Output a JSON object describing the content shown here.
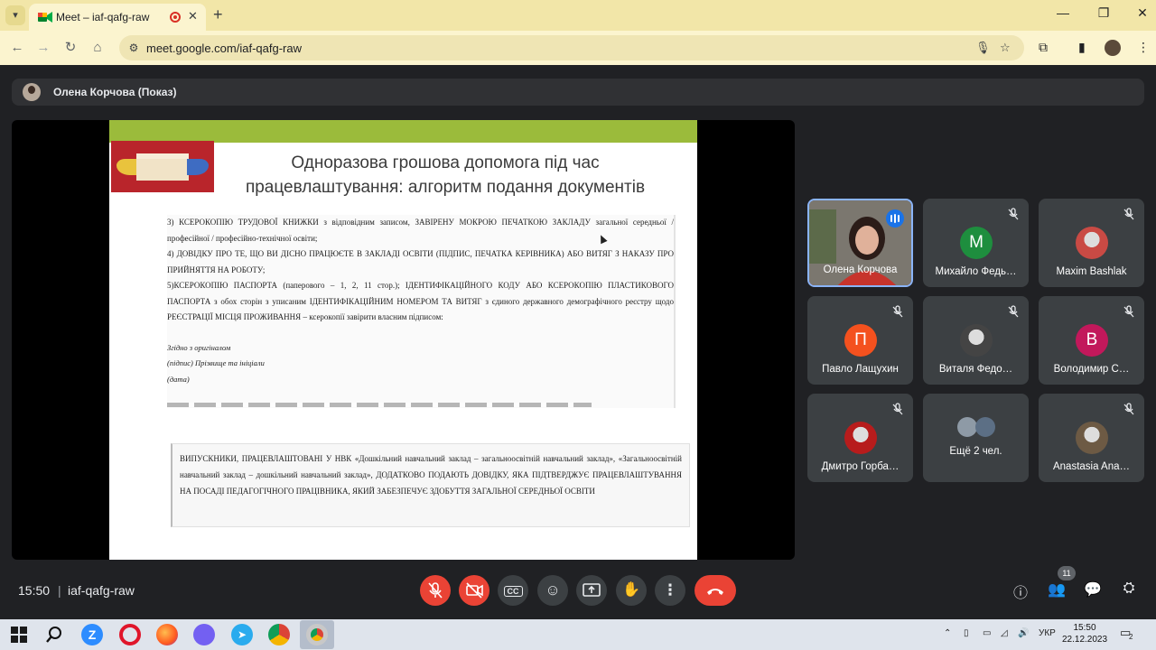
{
  "browser": {
    "tab_title": "Meet – iaf-qafg-raw",
    "url": "meet.google.com/iaf-qafg-raw",
    "tab_close": "✕",
    "new_tab": "+",
    "accent": "#f2e6a8"
  },
  "meet": {
    "presenter_label": "Олена Корчова (Показ)",
    "time": "15:50",
    "separator": "|",
    "meeting_code": "iaf-qafg-raw",
    "participant_count": "11"
  },
  "slide": {
    "title_line1": "Одноразова грошова допомога під час",
    "title_line2": "працевлаштування: алгоритм подання документів",
    "doc1": {
      "p1": "3) КСЕРОКОПІЮ ТРУДОВОЇ КНИЖКИ з відповідним записом, ЗАВІРЕНУ МОКРОЮ ПЕЧАТКОЮ ЗАКЛАДУ загальної середньої / професійної / професійно-технічної освіти;",
      "p2": "4) ДОВІДКУ ПРО ТЕ, ЩО ВИ ДІСНО ПРАЦЮЄТЕ В ЗАКЛАДІ ОСВІТИ (ПІДПИС, ПЕЧАТКА КЕРІВНИКА) АБО ВИТЯГ З НАКАЗУ ПРО ПРИЙНЯТТЯ НА РОБОТУ;",
      "p3": "5)КСЕРОКОПІЮ ПАСПОРТА (паперового – 1, 2, 11 стор.); ІДЕНТИФІКАЦІЙНОГО КОДУ АБО КСЕРОКОПІЮ ПЛАСТИКОВОГО ПАСПОРТА з обох сторін з уписаним ІДЕНТИФІКАЦІЙНИМ НОМЕРОМ ТА ВИТЯГ з єдиного державного демографічного реєстру щодо РЕЄСТРАЦІЇ МІСЦЯ ПРОЖИВАННЯ – ксерокопії завірити власним підписом:",
      "sig1": "Згідно з оригіналом",
      "sig2": "(підпис) Прізвище та ініціали",
      "sig3": "(дата)"
    },
    "doc2": "ВИПУСКНИКИ, ПРАЦЕВЛАШТОВАНІ У НВК «Дошкільний навчальний заклад – загальноосвітній навчальний заклад», «Загальноосвітній навчальний заклад – дошкільний навчальний заклад», ДОДАТКОВО ПОДАЮТЬ ДОВІДКУ, ЯКА ПІДТВЕРДЖУЄ ПРАЦЕВЛАШТУВАННЯ НА ПОСАДІ ПЕДАГОГІЧНОГО ПРАЦІВНИКА, ЯКИЙ ЗАБЕЗПЕЧУЄ ЗДОБУТТЯ ЗАГАЛЬНОЇ СЕРЕДНЬОЇ ОСВІТИ"
  },
  "tiles": [
    {
      "name": "Олена Корчова",
      "kind": "video",
      "speaking": true
    },
    {
      "name": "Михайло Федь…",
      "kind": "letter",
      "letter": "М",
      "color": "#1e8e3e"
    },
    {
      "name": "Maxim Bashlak",
      "kind": "pic",
      "color": "#c94a44"
    },
    {
      "name": "Павло Лащухин",
      "kind": "letter",
      "letter": "П",
      "color": "#f4511e"
    },
    {
      "name": "Виталя Федо…",
      "kind": "pic",
      "color": "#444444"
    },
    {
      "name": "Володимир С…",
      "kind": "letter",
      "letter": "В",
      "color": "#c2185b"
    },
    {
      "name": "Дмитро Горба…",
      "kind": "pic",
      "color": "#b71c1c"
    },
    {
      "name": "Ещё 2 чел.",
      "kind": "more"
    },
    {
      "name": "Anastasia Ana…",
      "kind": "pic",
      "color": "#6d5a44"
    }
  ],
  "taskbar": {
    "lang": "УКР",
    "clock_time": "15:50",
    "clock_date": "22.12.2023",
    "notif_count": "2"
  }
}
